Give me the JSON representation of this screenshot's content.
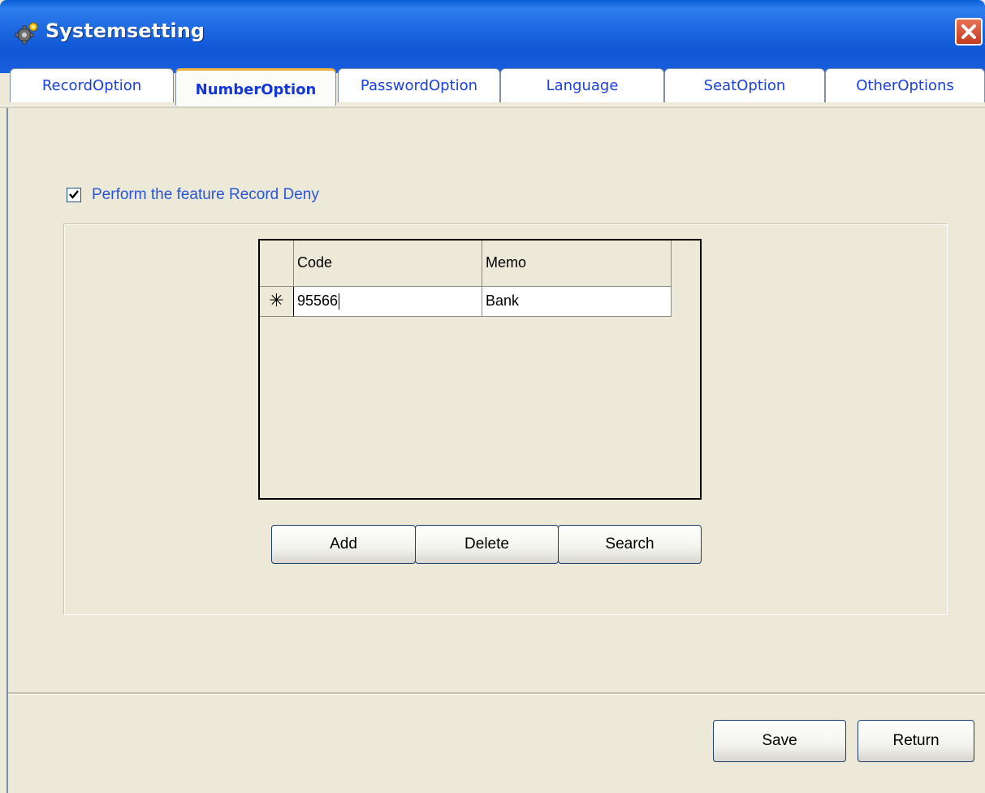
{
  "window": {
    "title": "Systemsetting",
    "icon": "gear-icon",
    "close_icon": "close-icon"
  },
  "tabs": [
    {
      "label": "RecordOption",
      "active": false
    },
    {
      "label": "NumberOption",
      "active": true
    },
    {
      "label": "PasswordOption",
      "active": false
    },
    {
      "label": "Language",
      "active": false
    },
    {
      "label": "SeatOption",
      "active": false
    },
    {
      "label": "OtherOptions",
      "active": false
    }
  ],
  "record_deny": {
    "label": "Perform the feature Record Deny",
    "checked": true
  },
  "grid": {
    "columns": [
      "Code",
      "Memo"
    ],
    "rows": [
      {
        "indicator": "✳",
        "code": "95566",
        "memo": "Bank"
      }
    ]
  },
  "grid_buttons": {
    "add": "Add",
    "delete": "Delete",
    "search": "Search"
  },
  "footer": {
    "save": "Save",
    "return": "Return"
  },
  "colors": {
    "titlebar": "#1d68e0",
    "tab_text": "#1a3fe0",
    "active_tab_accent": "#f0b43a",
    "checkbox_label": "#2a55d6",
    "background": "#ece9d8"
  }
}
